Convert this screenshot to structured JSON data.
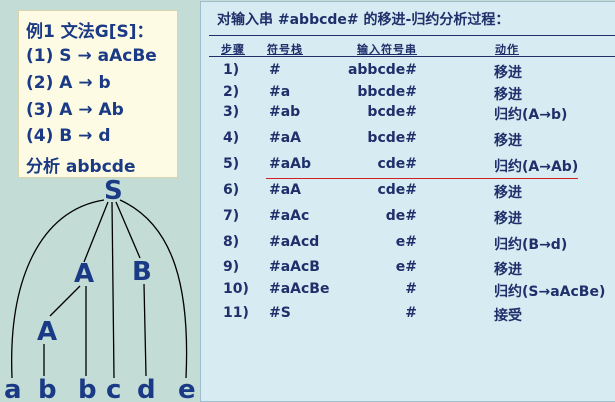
{
  "grammar": {
    "title": "例1 文法G[S]：",
    "rules": [
      "(1) S → aAcBe",
      "(2) A → b",
      "(3) A → Ab",
      "(4) B → d"
    ],
    "analyze": "分析 abbcde"
  },
  "tree": {
    "root": "S",
    "nodes": [
      "A",
      "B",
      "A"
    ],
    "leaves": [
      "a",
      "b",
      "b",
      "c",
      "d",
      "e"
    ]
  },
  "table": {
    "title": "对输入串 #abbcde# 的移进-归约分析过程：",
    "headers": [
      "步骤",
      "符号栈",
      "输入符号串",
      "动作"
    ],
    "rows": [
      {
        "step": "1)",
        "stack": "#",
        "input": "abbcde#",
        "action": "移进"
      },
      {
        "step": "2)",
        "stack": "#a",
        "input": "bbcde#",
        "action": "移进"
      },
      {
        "step": "3)",
        "stack": "#ab",
        "input": "bcde#",
        "action": "归约(A→b)"
      },
      {
        "step": "4)",
        "stack": "#aA",
        "input": "bcde#",
        "action": "移进"
      },
      {
        "step": "5)",
        "stack": "#aAb",
        "input": "cde#",
        "action": "归约(A→Ab)"
      },
      {
        "step": "6)",
        "stack": "#aA",
        "input": "cde#",
        "action": "移进"
      },
      {
        "step": "7)",
        "stack": "#aAc",
        "input": "de#",
        "action": "移进"
      },
      {
        "step": "8)",
        "stack": "#aAcd",
        "input": "e#",
        "action": "归约(B→d)"
      },
      {
        "step": "9)",
        "stack": "#aAcB",
        "input": "e#",
        "action": "移进"
      },
      {
        "step": "10)",
        "stack": "#aAcBe",
        "input": "#",
        "action": "归约(S→aAcBe)"
      },
      {
        "step": "11)",
        "stack": "#S",
        "input": "#",
        "action": "接受"
      }
    ]
  },
  "colors": {
    "text": "#1a3a86",
    "divider": "#d02020",
    "panel": "#d7ebf2",
    "box": "#fdfbe3"
  }
}
